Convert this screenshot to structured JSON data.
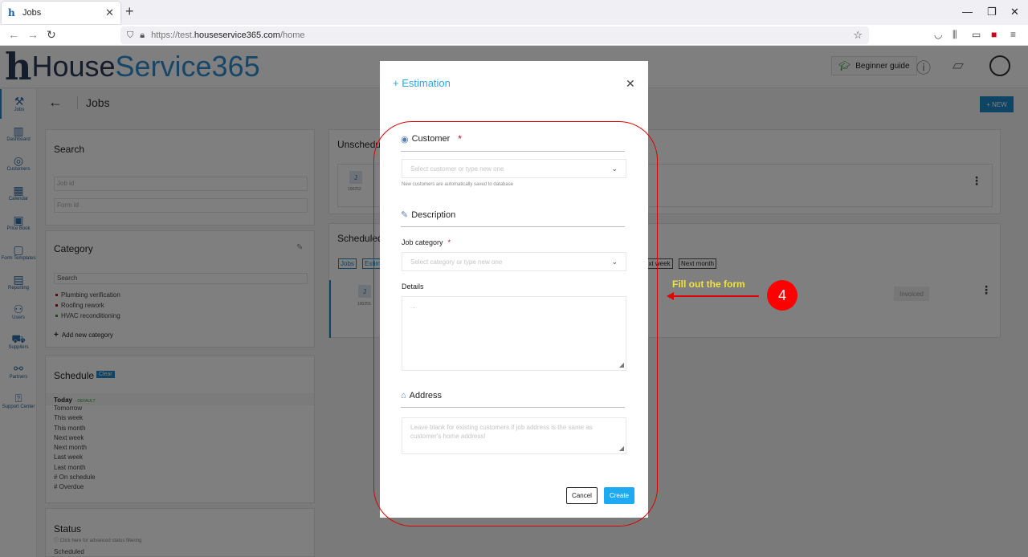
{
  "browser": {
    "tab_title": "Jobs",
    "url_prefix": "https://test.",
    "url_domain": "houseservice365.com",
    "url_path": "/home"
  },
  "app": {
    "logo_letter": "h",
    "logo_house": "House",
    "logo_service": "Service365",
    "beginner_guide": "Beginner guide",
    "page_title": "Jobs",
    "new_button": "+ NEW",
    "sidebar": [
      {
        "label": "Jobs",
        "icon": "tools-icon"
      },
      {
        "label": "Dashboard",
        "icon": "chart-icon"
      },
      {
        "label": "Customers",
        "icon": "customers-icon"
      },
      {
        "label": "Calendar",
        "icon": "calendar-icon"
      },
      {
        "label": "Price Book",
        "icon": "price-book-icon"
      },
      {
        "label": "Form Templates",
        "icon": "form-icon"
      },
      {
        "label": "Reporting",
        "icon": "report-icon"
      },
      {
        "label": "Users",
        "icon": "users-icon"
      },
      {
        "label": "Suppliers",
        "icon": "truck-icon"
      },
      {
        "label": "Partners",
        "icon": "partners-icon"
      },
      {
        "label": "Support Center",
        "icon": "help-icon"
      }
    ],
    "search": {
      "title": "Search",
      "job_id_placeholder": "Job id",
      "form_id_placeholder": "Form id"
    },
    "category": {
      "title": "Category",
      "search_placeholder": "Search",
      "items": [
        {
          "label": "Plumbing verification",
          "color": "#d0021b"
        },
        {
          "label": "Roofing rework",
          "color": "#d0021b"
        },
        {
          "label": "HVAC reconditioning",
          "color": "#2e9e3c"
        }
      ],
      "add_label": "Add new category"
    },
    "schedule": {
      "title": "Schedule",
      "clear_label": "Clear",
      "today": "Today",
      "default_tag": "- DEFAULT",
      "items": [
        "Tomorrow",
        "This week",
        "This month",
        "Next week",
        "Next month",
        "Last week",
        "Last month",
        "# On schedule",
        "# Overdue"
      ]
    },
    "status": {
      "title": "Status",
      "hint": "Click here for advanced status filtering",
      "first_item": "Scheduled"
    },
    "unscheduled": {
      "title": "Unschedul",
      "badge": "J",
      "number": "100252"
    },
    "scheduled": {
      "title": "Scheduled",
      "chip_jobs": "Jobs",
      "chip_estim": "Estim",
      "chip_next_week": "ext week",
      "chip_next_month": "Next month",
      "badge": "J",
      "number": "100255",
      "status": "Invoiced"
    }
  },
  "modal": {
    "title": "+ Estimation",
    "customer_label": "Customer",
    "required_mark": "*",
    "customer_placeholder": "Select customer or type new one",
    "customer_hint": "New customers are automatically saved to database",
    "description_label": "Description",
    "job_category_label": "Job category",
    "job_category_placeholder": "Select category or type new one",
    "details_label": "Details",
    "details_placeholder": "...",
    "address_label": "Address",
    "address_placeholder": "Leave blank for existing customers if job address is the same as customer's home address!",
    "cancel_label": "Cancel",
    "create_label": "Create"
  },
  "annotation": {
    "text": "Fill out the form",
    "step_number": "4",
    "color": "#e00000",
    "text_color": "#f3e23c"
  },
  "colors": {
    "accent": "#2aa8df",
    "primary_button": "#1eaaf1",
    "brand_dark": "#2a3b57",
    "brand_blue": "#2e8fd0"
  }
}
